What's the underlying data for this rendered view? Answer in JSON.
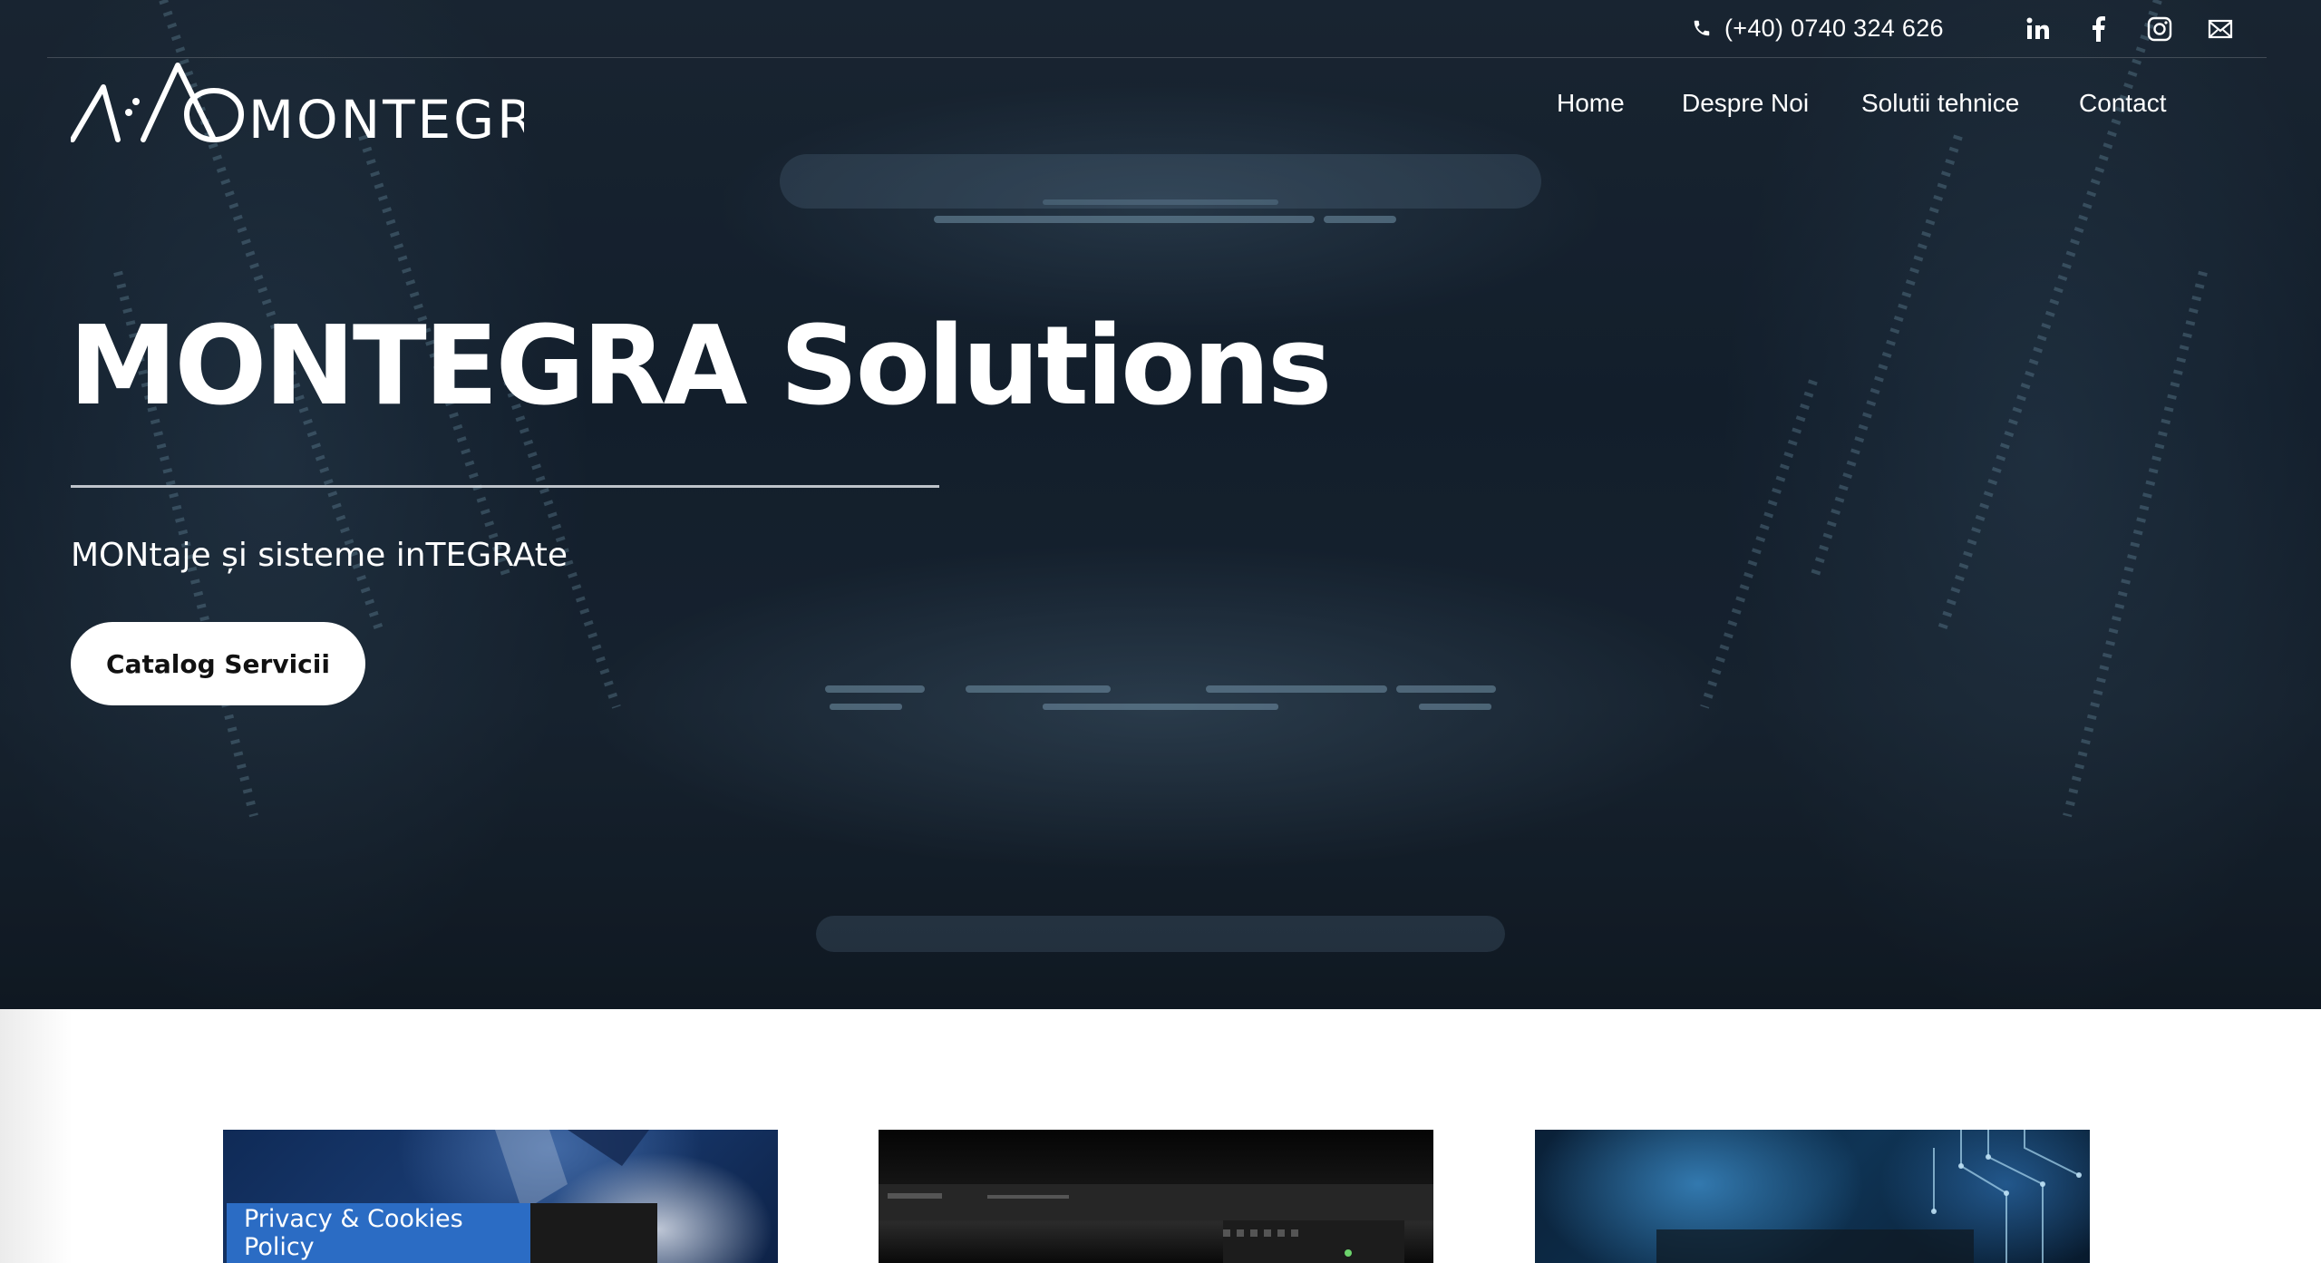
{
  "topbar": {
    "phone": "(+40) 0740 324 626",
    "phone_icon": "phone-icon",
    "social_icons": [
      "linkedin-icon",
      "facebook-icon",
      "instagram-icon",
      "email-icon"
    ]
  },
  "brand": {
    "logo_text": "MONTEGRA"
  },
  "nav": {
    "items": [
      {
        "label": "Home"
      },
      {
        "label": "Despre Noi"
      },
      {
        "label": "Solutii tehnice"
      },
      {
        "label": "Contact"
      }
    ]
  },
  "hero": {
    "title": "MONTEGRA Solutions",
    "subtitle": "MONtaje și sisteme inTEGRAte",
    "cta_label": "Catalog Servicii"
  },
  "cookie": {
    "label": "Privacy & Cookies Policy"
  },
  "colors": {
    "hero_bg": "#152231",
    "text": "#ffffff",
    "button_bg": "#ffffff",
    "privacy_tab": "#2b6cc4"
  }
}
